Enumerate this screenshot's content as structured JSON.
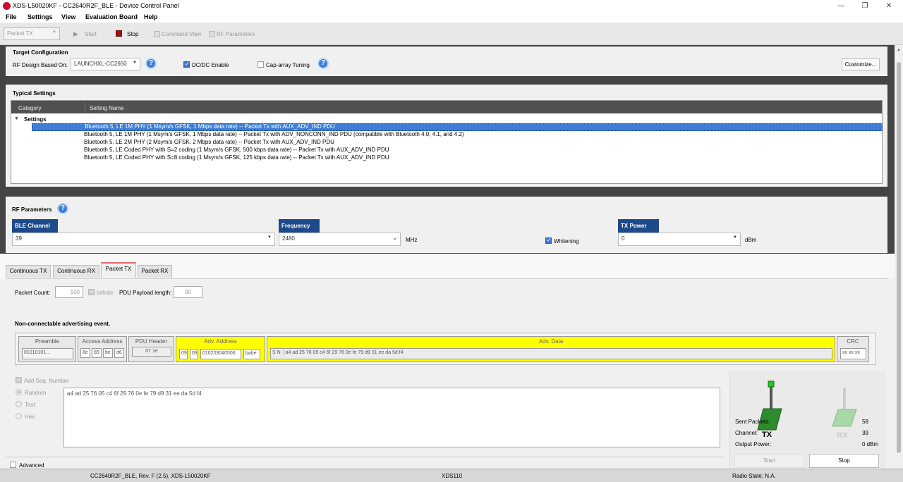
{
  "window": {
    "title": "XDS-L50020KF - CC2640R2F_BLE - Device Control Panel"
  },
  "menu": [
    "File",
    "Settings",
    "View",
    "Evaluation Board",
    "Help"
  ],
  "toolbar": {
    "mode": "Packet TX",
    "start": "Start",
    "stop": "Stop",
    "command_view": "Command View",
    "rf_parameters": "RF Parameters"
  },
  "target": {
    "heading": "Target Configuration",
    "rf_design_label": "RF Design Based On:",
    "rf_design_value": "LAUNCHXL-CC2650",
    "dcdc_label": "DC/DC Enable",
    "cap_label": "Cap-array Tuning",
    "customize": "Customize..."
  },
  "typical": {
    "heading": "Typical Settings",
    "col_category": "Category",
    "col_name": "Setting Name",
    "group": "Settings",
    "rows": [
      "Bluetooth 5, LE 1M PHY (1 Msym/s GFSK, 1 Mbps data rate) -- Packet Tx with AUX_ADV_IND PDU",
      "Bluetooth 5, LE 1M PHY (1 Msym/s GFSK, 1 Mbps data rate) -- Packet Tx with ADV_NONCONN_IND PDU (compatible with Bluetooth 4.0, 4.1, and 4.2)",
      "Bluetooth 5, LE 2M PHY (2 Msym/s GFSK, 2 Mbps  data rate) -- Packet Tx with AUX_ADV_IND PDU",
      "Bluetooth 5, LE Coded PHY with S=2 coding (1 Msym/s GFSK, 500 kbps data rate) -- Packet Tx with AUX_ADV_IND PDU",
      "Bluetooth 5, LE Coded PHY with S=8 coding (1 Msym/s GFSK, 125 kbps data rate) -- Packet Tx with AUX_ADV_IND PDU"
    ]
  },
  "rf": {
    "heading": "RF Parameters",
    "ble_channel_label": "BLE Channel",
    "ble_channel_value": "39",
    "frequency_label": "Frequency",
    "frequency_value": "2480",
    "frequency_unit": "MHz",
    "whitening": "Whitening",
    "tx_power_label": "TX Power",
    "tx_power_value": "0",
    "tx_power_unit": "dBm"
  },
  "tabs": [
    "Continuous TX",
    "Continuous RX",
    "Packet TX",
    "Packet RX"
  ],
  "packet": {
    "count_label": "Packet Count:",
    "count_value": "100",
    "infinite": "Infinite",
    "payload_label": "PDU Payload length:",
    "payload_value": "30",
    "event_heading": "Non-connectable advertising event.",
    "preamble_label": "Preamble",
    "preamble_value": "01010101...",
    "access_label": "Access Address",
    "access_bytes": [
      "8e",
      "89",
      "be",
      "d6"
    ],
    "pdu_header_label": "PDU Header",
    "pdu_header_value": "07 1e",
    "adv_addr_label": "Adv. Address",
    "adv_addr_b1": "09",
    "adv_addr_b2": "09",
    "adv_addr_b3": "010203040506",
    "adv_addr_b4": "babe",
    "adv_data_label": "Adv. Data",
    "adv_data_prefix": "S N",
    "adv_data_value": "a4 ad 25 76 05 c4 6f 29 76 0e fe 79 d9 31 ee da 5d f4",
    "crc_label": "CRC",
    "crc_value": "xx xx xx",
    "seq_label": "Add Seq. Number",
    "random": "Random",
    "text": "Text",
    "hex": "Hex",
    "payload_text": "a4 ad 25 76 05 c4 6f 29 76 0e fe 79 d9 31 ee da 5d f4",
    "advanced": "Advanced"
  },
  "stats": {
    "sent_label": "Sent Packets:",
    "sent_value": "58",
    "channel_label": "Channel:",
    "channel_value": "39",
    "power_label": "Output Power:",
    "power_value": "0 dBm",
    "tx": "TX",
    "rx": "RX",
    "start": "Start",
    "stop": "Stop"
  },
  "status": {
    "device": "CC2640R2F_BLE, Rev. F (2.5), XDS-L50020KF",
    "probe": "XDS110",
    "radio": "Radio State: N.A."
  },
  "colors": {
    "header_blue": "#1d4a8a",
    "selection": "#3d7fd6",
    "highlight_yellow": "#ffff00",
    "led_green": "#22cc22"
  }
}
